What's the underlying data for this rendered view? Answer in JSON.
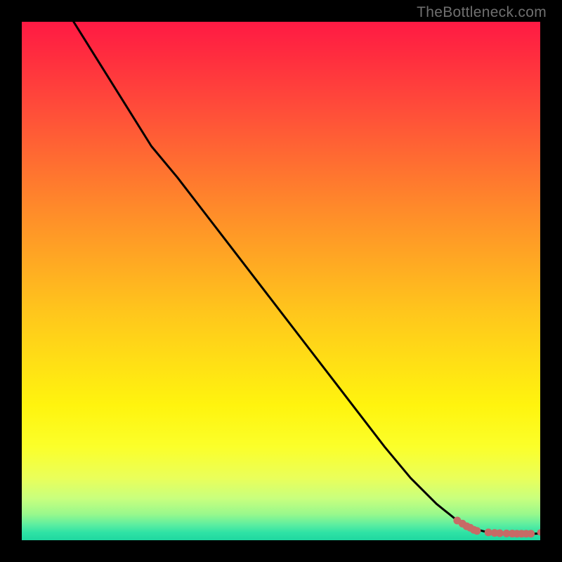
{
  "credit_text": "TheBottleneck.com",
  "colors": {
    "frame": "#000000",
    "gradient_top": "#ff1a44",
    "gradient_mid": "#fff40e",
    "gradient_bottom": "#1fd8a0",
    "line": "#000000",
    "marker": "#c76a66"
  },
  "chart_data": {
    "type": "line",
    "title": "",
    "xlabel": "",
    "ylabel": "",
    "xlim": [
      0,
      100
    ],
    "ylim": [
      0,
      100
    ],
    "grid": false,
    "legend": false,
    "series": [
      {
        "name": "curve",
        "x": [
          10,
          15,
          20,
          25,
          30,
          35,
          40,
          45,
          50,
          55,
          60,
          65,
          70,
          75,
          80,
          85,
          88,
          90,
          92,
          94,
          96,
          97.5,
          100
        ],
        "values": [
          100,
          92,
          84,
          76,
          70,
          63.5,
          57,
          50.5,
          44,
          37.5,
          31,
          24.5,
          18,
          12,
          7,
          3,
          2,
          1.5,
          1.3,
          1.2,
          1.2,
          1.2,
          1.3
        ]
      }
    ],
    "markers": {
      "name": "dots",
      "x": [
        84,
        85,
        85.8,
        86.5,
        87.2,
        87.8,
        90.0,
        91.2,
        92.2,
        93.5,
        94.6,
        95.5,
        96.4,
        97.3,
        98.2,
        100
      ],
      "values": [
        3.8,
        3.2,
        2.7,
        2.4,
        2.0,
        1.8,
        1.5,
        1.4,
        1.35,
        1.3,
        1.28,
        1.26,
        1.25,
        1.25,
        1.25,
        1.5
      ]
    }
  }
}
